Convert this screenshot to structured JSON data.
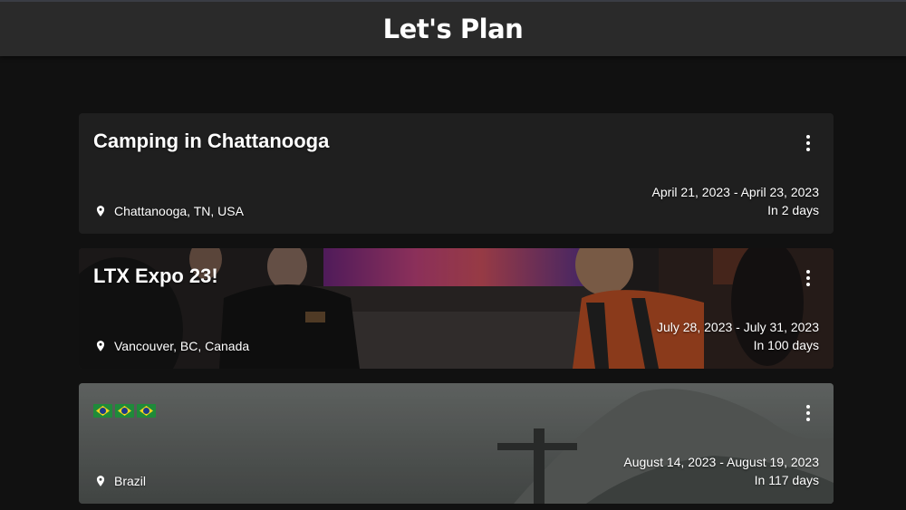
{
  "app": {
    "title": "Let's Plan"
  },
  "trips": [
    {
      "title": "Camping in Chattanooga",
      "location": "Chattanooga, TN, USA",
      "date_range": "April 21, 2023 - April 23, 2023",
      "countdown": "In 2 days",
      "background": "plain-dark"
    },
    {
      "title": "LTX Expo 23!",
      "location": "Vancouver, BC, Canada",
      "date_range": "July 28, 2023 - July 31, 2023",
      "countdown": "In 100 days",
      "background": "event-photo"
    },
    {
      "title": "🇧🇷🇧🇷🇧🇷",
      "location": "Brazil",
      "date_range": "August 14, 2023 - August 19, 2023",
      "countdown": "In 117 days",
      "background": "christ-the-redeemer-photo"
    }
  ],
  "icons": {
    "location": "location-pin-icon",
    "menu": "more-vertical-icon"
  },
  "colors": {
    "app_bar": "#2a2a2a",
    "page_background": "#111111",
    "card_background": "#1f1f1f",
    "text": "#ffffff"
  }
}
